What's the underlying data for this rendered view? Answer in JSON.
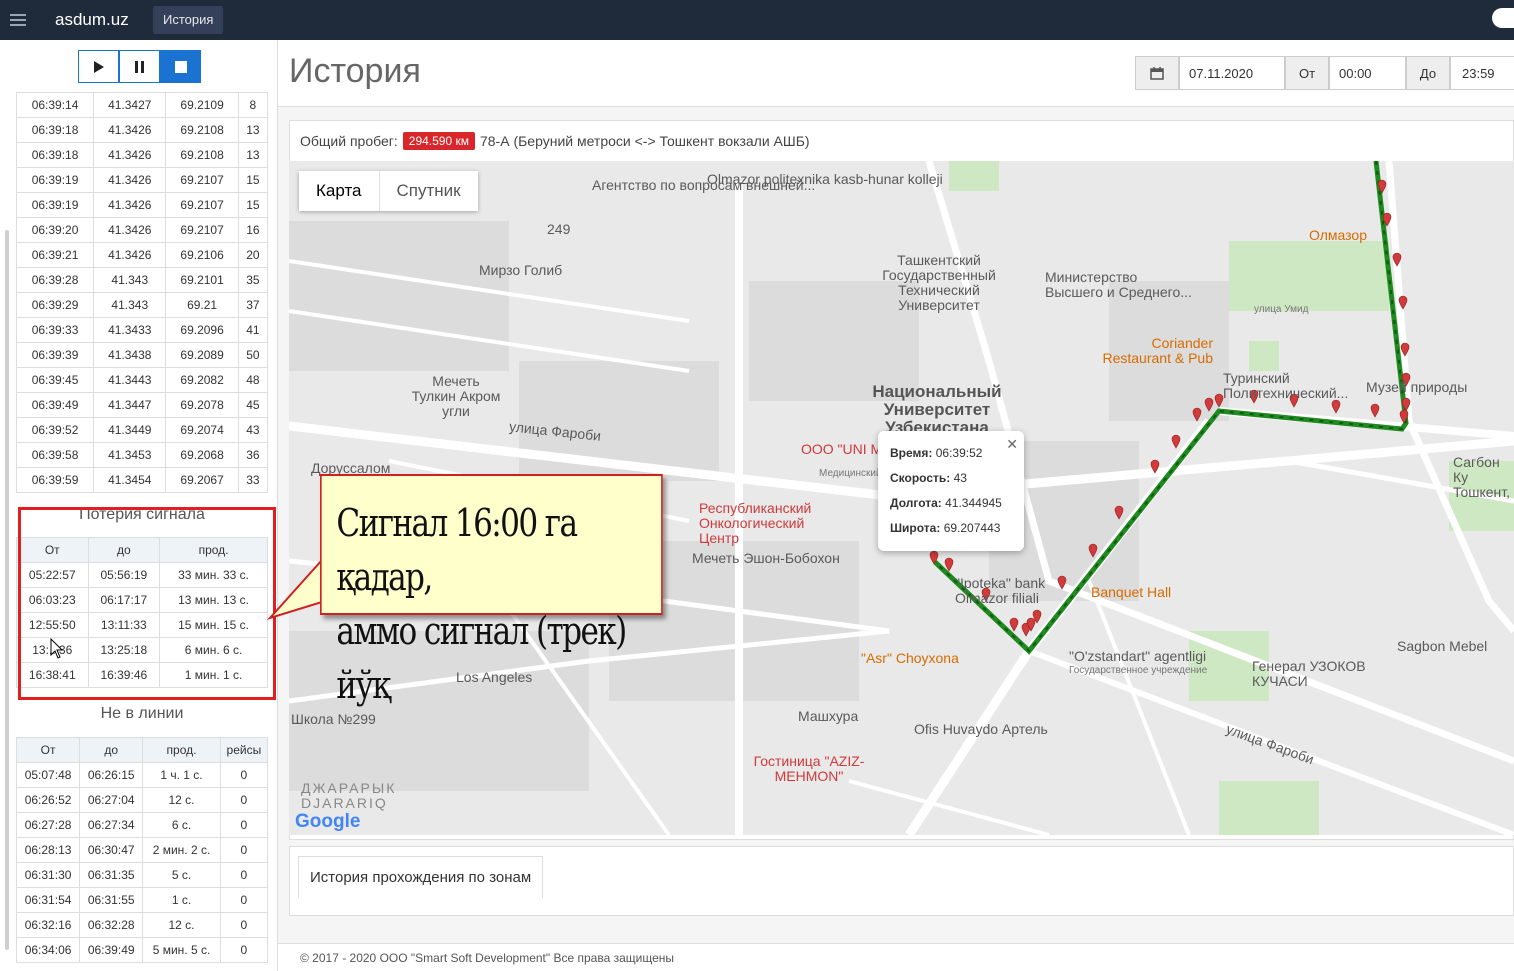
{
  "topbar": {
    "brand": "asdum.uz",
    "nav_tab": "История"
  },
  "player": {
    "buttons": [
      "play-icon",
      "pause-icon",
      "stop-icon"
    ]
  },
  "points": [
    [
      "06:39:14",
      "41.3427",
      "69.2109",
      "8"
    ],
    [
      "06:39:18",
      "41.3426",
      "69.2108",
      "13"
    ],
    [
      "06:39:18",
      "41.3426",
      "69.2108",
      "13"
    ],
    [
      "06:39:19",
      "41.3426",
      "69.2107",
      "15"
    ],
    [
      "06:39:19",
      "41.3426",
      "69.2107",
      "15"
    ],
    [
      "06:39:20",
      "41.3426",
      "69.2107",
      "16"
    ],
    [
      "06:39:21",
      "41.3426",
      "69.2106",
      "20"
    ],
    [
      "06:39:28",
      "41.343",
      "69.2101",
      "35"
    ],
    [
      "06:39:29",
      "41.343",
      "69.21",
      "37"
    ],
    [
      "06:39:33",
      "41.3433",
      "69.2096",
      "41"
    ],
    [
      "06:39:39",
      "41.3438",
      "69.2089",
      "50"
    ],
    [
      "06:39:45",
      "41.3443",
      "69.2082",
      "48"
    ],
    [
      "06:39:49",
      "41.3447",
      "69.2078",
      "45"
    ],
    [
      "06:39:52",
      "41.3449",
      "69.2074",
      "43"
    ],
    [
      "06:39:58",
      "41.3453",
      "69.2068",
      "36"
    ],
    [
      "06:39:59",
      "41.3454",
      "69.2067",
      "33"
    ]
  ],
  "signal_loss": {
    "title": "Потерия сигнала",
    "headers": [
      "От",
      "до",
      "прод."
    ],
    "rows": [
      [
        "05:22:57",
        "05:56:19",
        "33 мин. 33 с."
      ],
      [
        "06:03:23",
        "06:17:17",
        "13 мин. 13 с."
      ],
      [
        "12:55:50",
        "13:11:33",
        "15 мин. 15 с."
      ],
      [
        "13:..:36",
        "13:25:18",
        "6 мин. 6 с."
      ],
      [
        "16:38:41",
        "16:39:46",
        "1 мин. 1 с."
      ]
    ]
  },
  "offline": {
    "title": "Не в линии",
    "headers": [
      "От",
      "до",
      "прод.",
      "рейсы"
    ],
    "rows": [
      [
        "05:07:48",
        "06:26:15",
        "1 ч. 1 с.",
        "0"
      ],
      [
        "06:26:52",
        "06:27:04",
        "12 с.",
        "0"
      ],
      [
        "06:27:28",
        "06:27:34",
        "6 с.",
        "0"
      ],
      [
        "06:28:13",
        "06:30:47",
        "2 мин. 2 с.",
        "0"
      ],
      [
        "06:31:30",
        "06:31:35",
        "5 с.",
        "0"
      ],
      [
        "06:31:54",
        "06:31:55",
        "1 с.",
        "0"
      ],
      [
        "06:32:16",
        "06:32:28",
        "12 с.",
        "0"
      ],
      [
        "06:34:06",
        "06:39:49",
        "5 мин. 5 с.",
        "0"
      ]
    ]
  },
  "main": {
    "title": "История",
    "date": "07.11.2020",
    "from_label": "От",
    "from_time": "00:00",
    "to_label": "До",
    "to_time": "23:59",
    "summary_label": "Общий пробег:",
    "mileage": "294.590 км",
    "route": "78-А (Беруний метроси <-> Тошкент вокзали АШБ)"
  },
  "map": {
    "tabs": [
      "Карта",
      "Спутник"
    ],
    "labels": {
      "agency": "Агентство по вопросам внешней...",
      "olmazor": "Olmazor politexnika kasb-hunar kolleji",
      "n249": "249",
      "mirzo": "Мирзо Голиб",
      "tgtu": "Ташкентский Государственный Технический Университет",
      "ministry": "Министерство Высшего и Среднего...",
      "olmazor2": "Олмазор",
      "coriander": "Coriander Restaurant & Pub",
      "turin": "Туринский Политехнический...",
      "museum": "Музей природы",
      "nuu": "Национальный Университет Узбекистана",
      "mosque1": "Мечеть Тулкин Акром угли",
      "unimed": "ООО \"UNI MEDICAL CA",
      "unimed2": "Медицинский ц",
      "doruss": "Доруссалом",
      "oncology": "Республиканский Онкологический Центр",
      "mosque2": "Мечеть Эшон-Бобохон",
      "ipoteka": "\"Ipoteka\" bank Olmazor filiali",
      "banquet": "Banquet Hall",
      "sagbon": "Сагбон Ку Тошкент,",
      "sagbon_mebel": "Sagbon Mebel",
      "asr": "\"Asr\" Choyxona",
      "ozst": "\"O'zstandart\" agentligi",
      "ozst2": "Государственное учреждение",
      "general": "Генерал УЗОКОВ КУЧАСИ",
      "losangeles": "Los Angeles",
      "school": "Школа №299",
      "mashhura": "Машхура",
      "ofis": "Ofis Huvaydo Артель",
      "hotel": "Гостиница \"AZIZ-MEHMON\"",
      "djararik": "ДЖАРАРЫК DJARARIQ",
      "farobi": "улица Фароби",
      "farobi2": "улица Фароби",
      "umid": "улица Умид",
      "google": "Google"
    },
    "info": {
      "time_label": "Время:",
      "time": "06:39:52",
      "speed_label": "Скорость:",
      "speed": "43",
      "lon_label": "Долгота:",
      "lon": "41.344945",
      "lat_label": "Широта:",
      "lat": "69.207443"
    },
    "callout_line1": "Сигнал 16:00 га қадар,",
    "callout_line2": "аммо сигнал (трек) йўқ"
  },
  "zones": {
    "tab": "История прохождения по зонам"
  },
  "footer": "© 2017 - 2020 ООО \"Smart Soft Development\" Все права защищены",
  "colors": {
    "topbar": "#1f2a3a",
    "accent": "#1a73d0",
    "badge": "#d9262a",
    "track": "#1f8a1f",
    "marker": "#d23b3b",
    "callout_bg": "#ffffcc"
  }
}
